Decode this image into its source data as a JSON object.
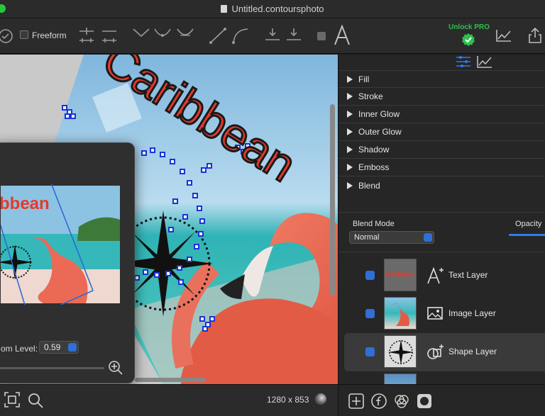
{
  "window": {
    "title": "Untitled.contoursphoto"
  },
  "toolbar": {
    "freeform_label": "Freeform",
    "unlock_label": "Unlock PRO",
    "icons": [
      "check-circle-icon",
      "add-point-icon",
      "remove-point-icon",
      "curve-corner-icon",
      "curve-smooth-icon",
      "curve-symmetric-icon",
      "line-icon",
      "arc-icon",
      "align-top-icon",
      "align-bottom-icon",
      "square-shape-icon",
      "text-tool-icon",
      "unlock-pro-icon",
      "chart-icon",
      "share-icon"
    ]
  },
  "canvas": {
    "image_text": "Caribbean",
    "dimensions": "1280 x 853"
  },
  "zoom_popover": {
    "thumb_text": "bbean",
    "zoom_label": "om Level:",
    "zoom_value": "0.59"
  },
  "panel": {
    "effects": [
      "Fill",
      "Stroke",
      "Inner Glow",
      "Outer Glow",
      "Shadow",
      "Emboss",
      "Blend"
    ],
    "blend_mode_label": "Blend Mode",
    "blend_mode_value": "Normal",
    "opacity_label": "Opacity",
    "layers": [
      {
        "name": "Text Layer",
        "thumb_text": "Caribbean",
        "icon": "text-layer-icon",
        "selected": false
      },
      {
        "name": "Image Layer",
        "icon": "image-layer-icon",
        "selected": false
      },
      {
        "name": "Shape Layer",
        "icon": "shape-layer-icon",
        "selected": true
      }
    ]
  },
  "colors": {
    "accent": "#2f7bf0",
    "pro_green": "#2ec04c",
    "text_red": "#e8392b"
  }
}
